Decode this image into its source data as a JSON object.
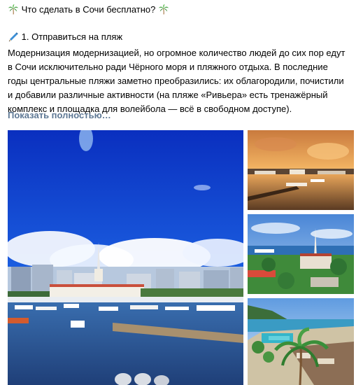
{
  "post": {
    "title": "Что сделать в Сочи бесплатно?",
    "heading_label": "1. Отправиться на пляж",
    "body": "Модернизация модернизацией, но огромное количество людей до сих пор едут\nв Сочи исключительно ради Чёрного моря и пляжного отдыха. В последние\nгоды центральные пляжи заметно преобразились: их облагородили, почистили\nи добавили различные активности (на пляже «Ривьера» есть тренажёрный\nкомплекс и площадка для волейбола — всё в свободном доступе).",
    "show_more": "Показать полностью…"
  },
  "icons": {
    "title_left": "palm-tree-icon",
    "title_right": "palm-tree-icon",
    "heading": "pen-icon"
  },
  "photos": [
    "sochi-seaport-marina-photo",
    "sunset-marina-photo",
    "seaport-aerial-photo",
    "beach-promenade-photo"
  ],
  "colors": {
    "link": "#5e7894",
    "text": "#000000",
    "background": "#ffffff"
  }
}
